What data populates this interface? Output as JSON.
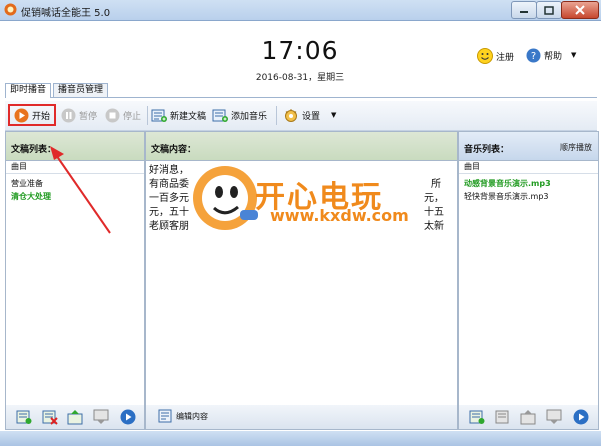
{
  "window": {
    "title": "促销喊话全能王 5.0"
  },
  "header": {
    "time": "17:06",
    "date": "2016-08-31，星期三",
    "register_label": "注册",
    "help_label": "帮助"
  },
  "tabs": [
    {
      "label": "即时播音"
    },
    {
      "label": "播音员管理"
    }
  ],
  "toolbar": {
    "start": "开始",
    "pause": "暂停",
    "stop": "停止",
    "new_doc": "新建文稿",
    "add_music": "添加音乐",
    "settings": "设置"
  },
  "left_panel": {
    "title": "文稿列表：",
    "column": "曲目",
    "items": [
      "营业准备",
      "清仓大处理"
    ]
  },
  "mid_panel": {
    "title": "文稿内容：",
    "lines": [
      "好消息，",
      "有商品委",
      "一百多元",
      "元，五十",
      "老顾客朋"
    ],
    "right_fragments": [
      "所",
      "元，",
      "十五",
      "太新"
    ],
    "edit_label": "编辑内容"
  },
  "right_panel": {
    "title": "音乐列表：",
    "play_mode": "顺序播放",
    "column": "曲目",
    "items": [
      "动感背景音乐演示.mp3",
      "轻快背景音乐演示.mp3"
    ]
  },
  "watermark": {
    "brand": "开心电玩",
    "url": "www.kxdw.com"
  },
  "colors": {
    "accent_green": "#1f9a1f",
    "highlight_red": "#e02a2a",
    "watermark": "#f08a1c"
  }
}
